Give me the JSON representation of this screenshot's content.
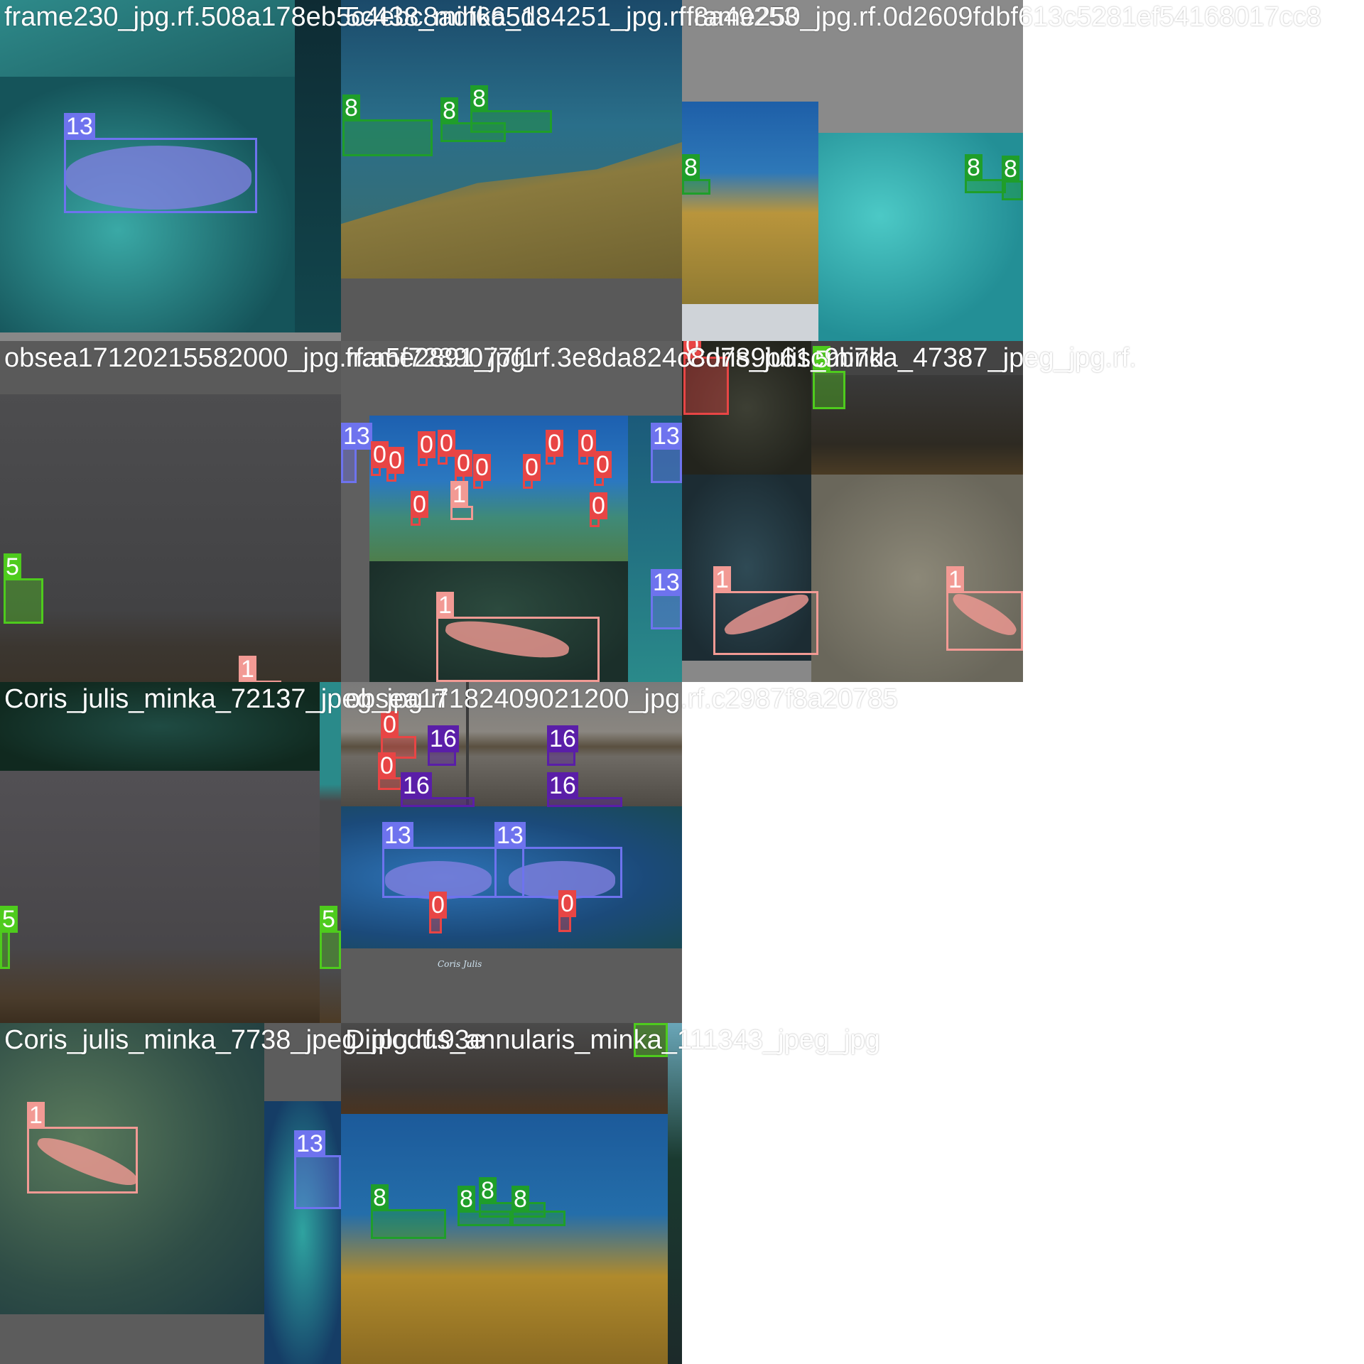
{
  "figure": {
    "type": "mosaic-grid-of-detection-samples",
    "background_color": "#ffffff",
    "class_colors": {
      "0": "#e84545",
      "1": "#f29a94",
      "5": "#4ecb1d",
      "8": "#1f9e2a",
      "13": "#6e73ee",
      "16": "#5a1ea8"
    }
  },
  "tiles": [
    {
      "title": "frame230_jpg.rf.508a178eb5c4ebc8adf665d8",
      "overflow_title": "5c438_minka_134251_jpg.rf.8a49253",
      "scene": "underwater reef, teal",
      "boxes": [
        {
          "label": "13"
        }
      ]
    },
    {
      "title": "5c438_minka_134251_jpg.rf.8a49253",
      "scene": "underwater rock slope, blue water",
      "boxes": [
        {
          "label": "8"
        },
        {
          "label": "8"
        },
        {
          "label": "8"
        }
      ]
    },
    {
      "title": "frame250_jpg.rf.0d2609fdbf613c5281ef54168017cc8",
      "scene": "reef and rock mosaic",
      "boxes": [
        {
          "label": "8"
        },
        {
          "label": "8"
        },
        {
          "label": "8"
        }
      ]
    },
    {
      "title": "obsea17120215582000_jpg.rf.a5f7289077f1",
      "scene": "murky grey water",
      "boxes": [
        {
          "label": "5"
        },
        {
          "label": "1"
        }
      ]
    },
    {
      "title": "frame2891_jpg.rf.3e8da824c8d789b61c9b7d",
      "scene": "school of fish over reef",
      "boxes": [
        {
          "label": "13"
        },
        {
          "label": "13"
        },
        {
          "label": "13"
        },
        {
          "label": "0"
        },
        {
          "label": "0"
        },
        {
          "label": "0"
        },
        {
          "label": "0"
        },
        {
          "label": "0"
        },
        {
          "label": "0"
        },
        {
          "label": "0"
        },
        {
          "label": "0"
        },
        {
          "label": "0"
        },
        {
          "label": "0"
        },
        {
          "label": "0"
        },
        {
          "label": "0"
        },
        {
          "label": "1"
        },
        {
          "label": "1"
        }
      ]
    },
    {
      "title": "Coris_julis_minka_47387_jpeg_jpg.rf.",
      "scene": "dark rocky seabed mosaic",
      "boxes": [
        {
          "label": "0"
        },
        {
          "label": "5"
        },
        {
          "label": "1"
        },
        {
          "label": "1"
        }
      ]
    },
    {
      "title": "Coris_julis_minka_72137_jpeg_jpg.rf",
      "scene": "murky grey water",
      "boxes": [
        {
          "label": "5"
        },
        {
          "label": "5"
        }
      ]
    },
    {
      "title": "obsea17182409021200_jpg.rf.c2987f8a20785",
      "scene": "pier pilings and reef",
      "boxes": [
        {
          "label": "0"
        },
        {
          "label": "0"
        },
        {
          "label": "16"
        },
        {
          "label": "16"
        },
        {
          "label": "16"
        },
        {
          "label": "16"
        },
        {
          "label": "13"
        },
        {
          "label": "13"
        },
        {
          "label": "0"
        },
        {
          "label": "0"
        }
      ],
      "watermark": "Coris Julis"
    },
    {
      "title": "Coris_julis_minka_7738_jpeg_jpg.rf.93e",
      "scene": "green algae wall",
      "boxes": [
        {
          "label": "1"
        },
        {
          "label": "13"
        }
      ]
    },
    {
      "title": "Diplodus_annularis_minka_111343_jpeg_jpg",
      "scene": "yellow rock under blue water",
      "boxes": [
        {
          "label": "5"
        },
        {
          "label": "8"
        },
        {
          "label": "8"
        },
        {
          "label": "8"
        },
        {
          "label": "8"
        }
      ]
    }
  ]
}
